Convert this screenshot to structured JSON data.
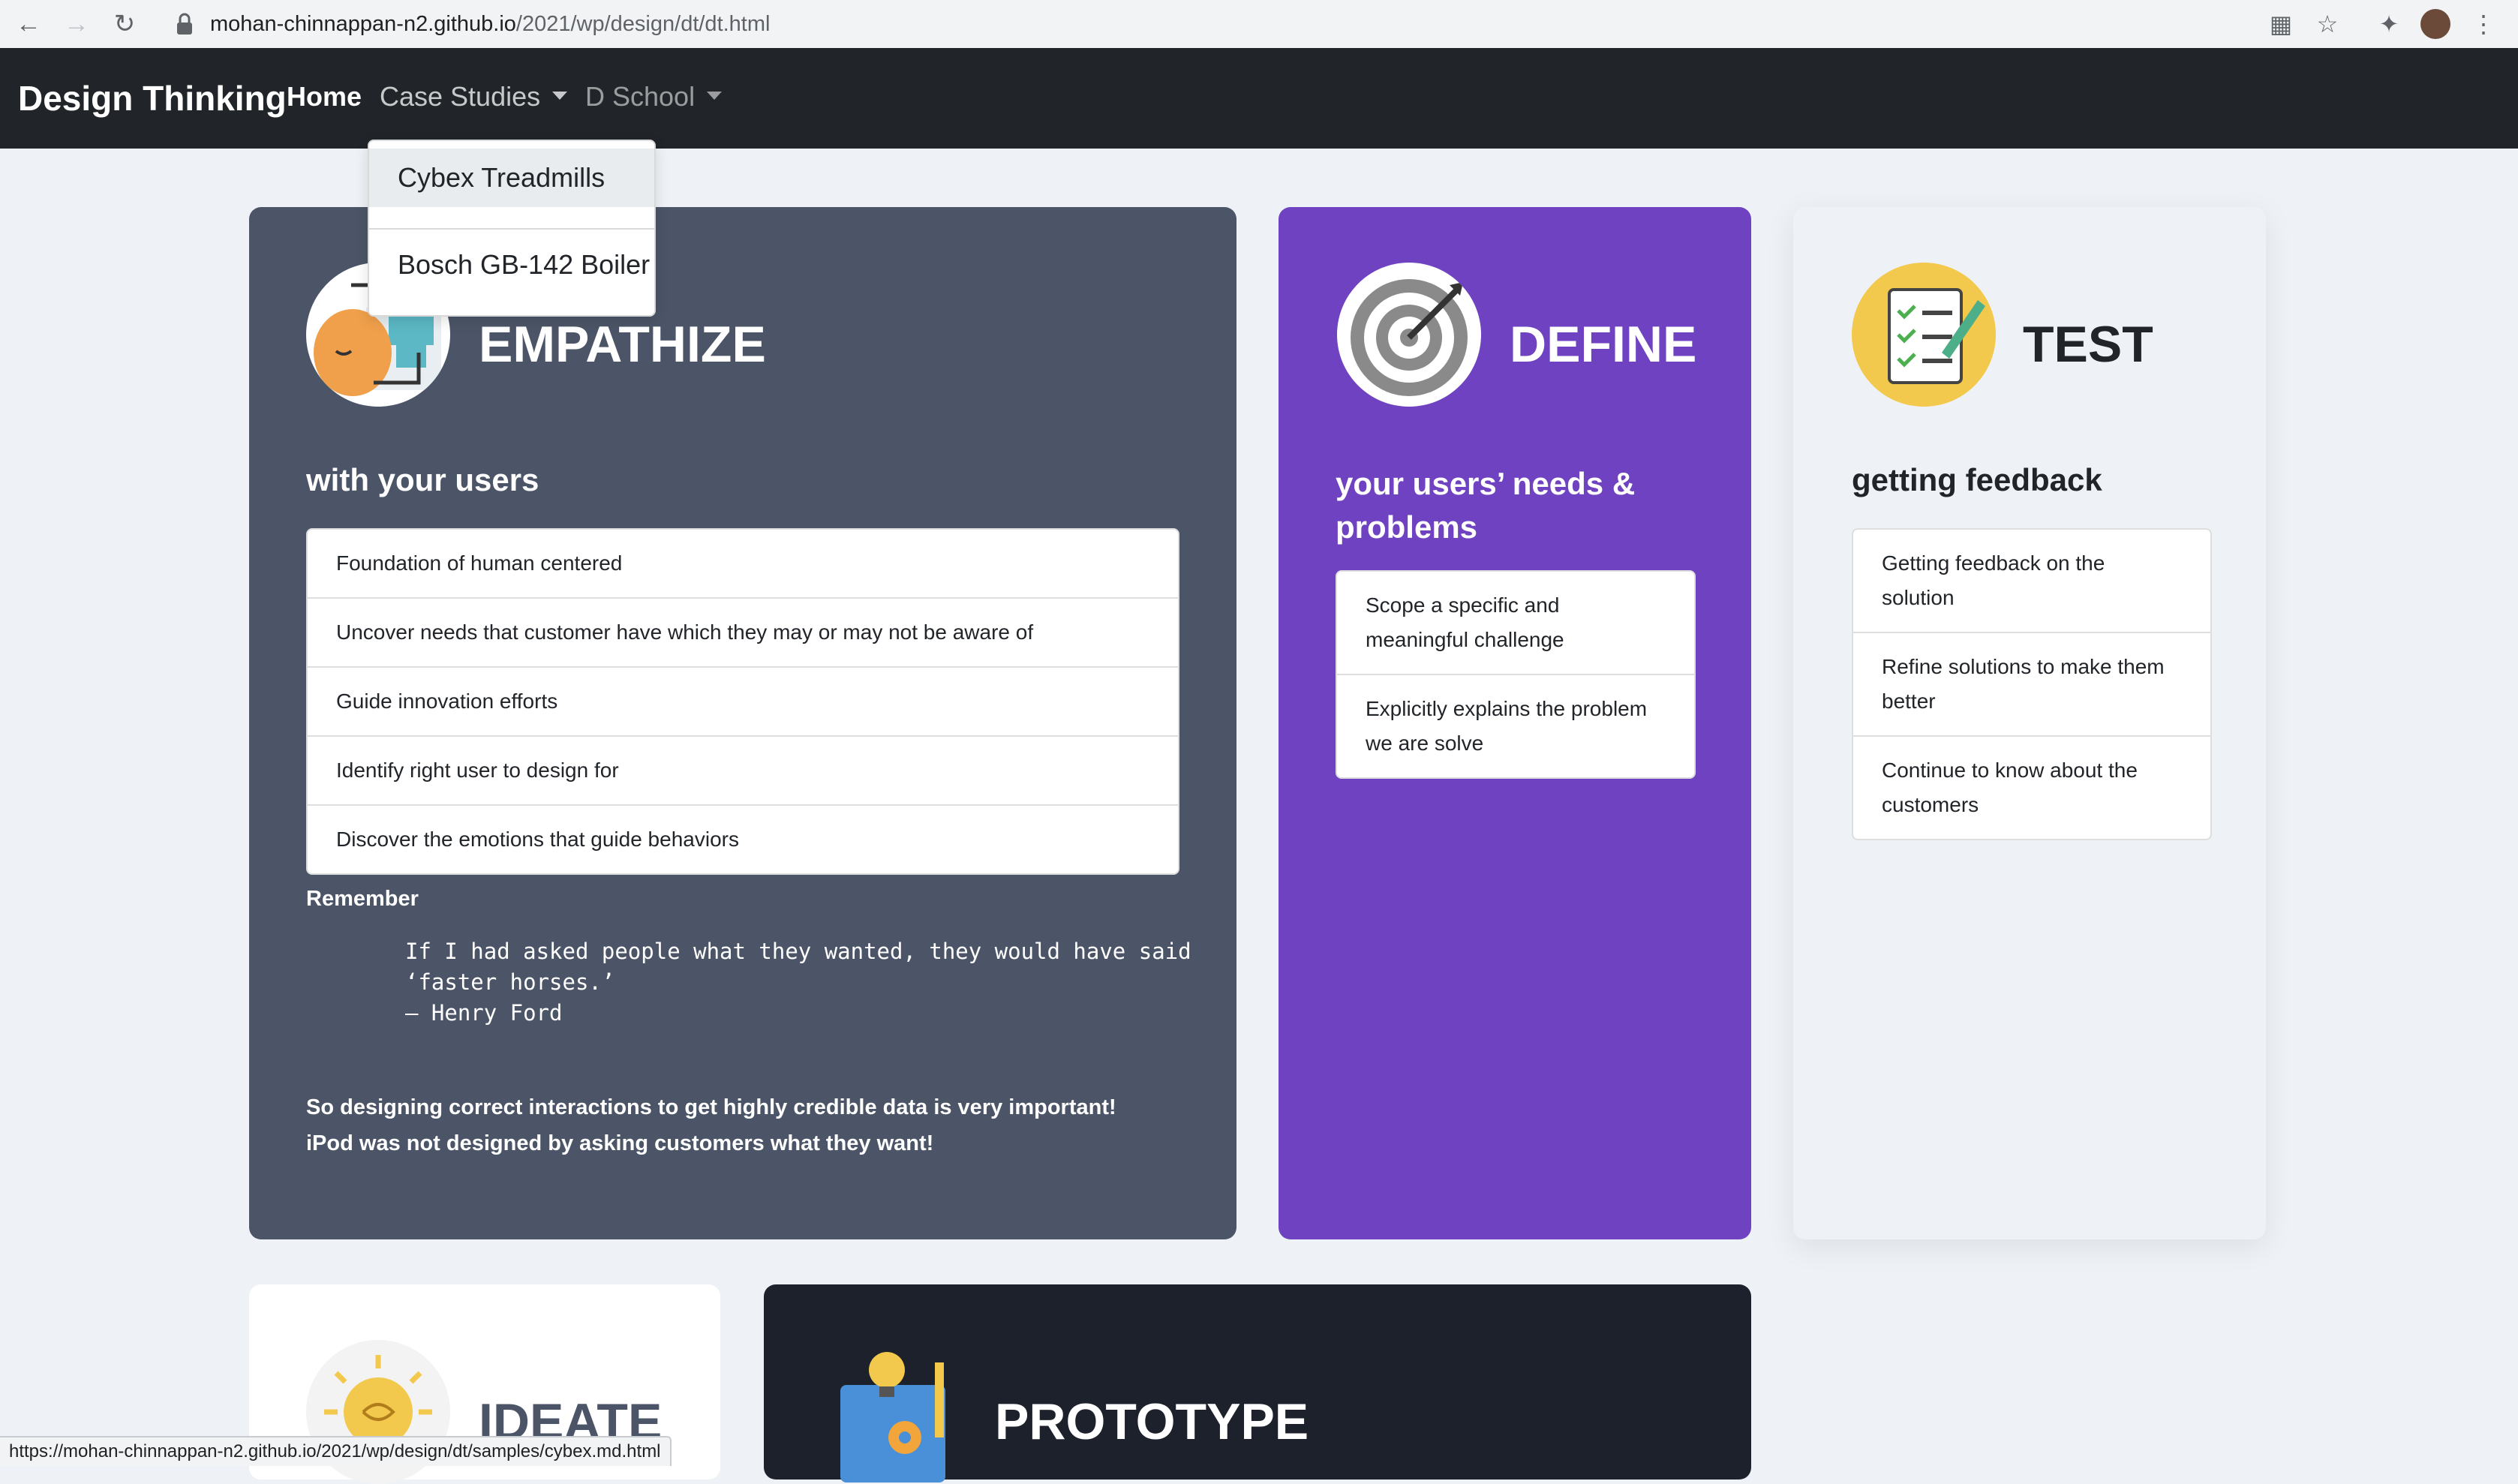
{
  "browser": {
    "url_host": "mohan-chinnappan-n2.github.io",
    "url_path": "/2021/wp/design/dt/dt.html",
    "status_url": "https://mohan-chinnappan-n2.github.io/2021/wp/design/dt/samples/cybex.md.html"
  },
  "navbar": {
    "brand": "Design Thinking",
    "home": "Home",
    "case_studies": "Case Studies",
    "d_school": "D School",
    "dropdown_items": [
      "Cybex Treadmills",
      "Bosch GB-142 Boiler"
    ]
  },
  "empathize": {
    "title": "EMPATHIZE",
    "subtitle": "with your users",
    "items": [
      "Foundation of human centered",
      "Uncover needs that customer have which they may or may not be aware of",
      "Guide innovation efforts",
      "Identify right user to design for",
      "Discover the emotions that guide behaviors"
    ],
    "remember": "Remember",
    "quote_lines": [
      "If I had asked people what they wanted, they would have said",
      "‘faster horses.’",
      "– Henry Ford"
    ],
    "closing_lines": [
      "So designing correct interactions to get highly credible data is very important!",
      "iPod was not designed by asking customers what they want!"
    ]
  },
  "define": {
    "title": "DEFINE",
    "subtitle_lines": [
      "your users’ needs &",
      "problems"
    ],
    "items": [
      [
        "Scope a specific and",
        "meaningful challenge"
      ],
      [
        "Explicitly explains the problem",
        "we are solve"
      ]
    ]
  },
  "test": {
    "title": "TEST",
    "subtitle": "getting feedback",
    "items": [
      [
        "Getting feedback on the",
        "solution"
      ],
      [
        "Refine solutions to make them",
        "better"
      ],
      [
        "Continue to know about the",
        "customers"
      ]
    ]
  },
  "ideate": {
    "title": "IDEATE"
  },
  "prototype": {
    "title": "PROTOTYPE"
  },
  "colors": {
    "navbar": "#212529",
    "empathize_bg": "#4b5567",
    "define_bg": "#6f42c1",
    "test_bg": "#eef2f6",
    "prototype_bg": "#1c212b"
  }
}
